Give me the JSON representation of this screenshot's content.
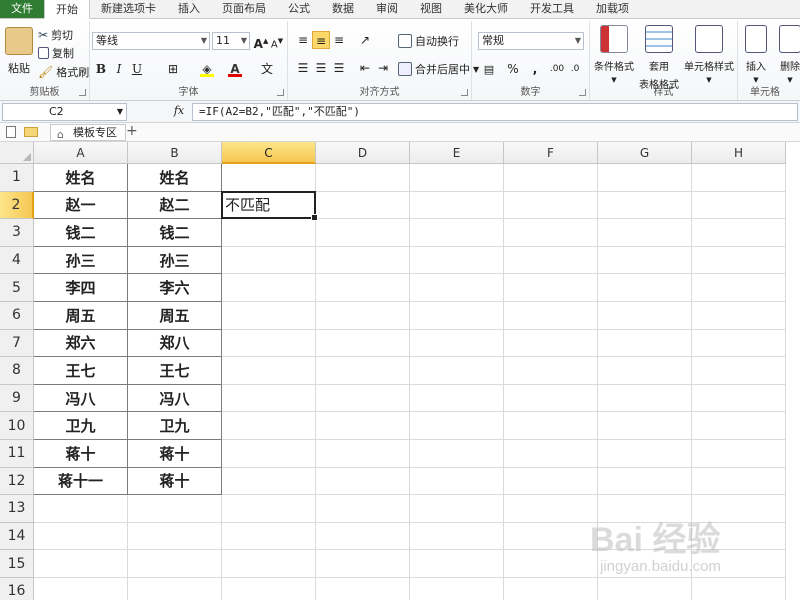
{
  "ribbon_tabs": [
    "文件",
    "开始",
    "新建选项卡",
    "插入",
    "页面布局",
    "公式",
    "数据",
    "审阅",
    "视图",
    "美化大师",
    "开发工具",
    "加载项"
  ],
  "active_tab": "开始",
  "clipboard": {
    "paste": "粘贴",
    "cut": "剪切",
    "copy": "复制",
    "format_painter": "格式刷",
    "label": "剪贴板"
  },
  "font": {
    "name": "等线",
    "size": "11",
    "grow": "A",
    "shrink": "A",
    "bold": "B",
    "italic": "I",
    "underline": "U",
    "label": "字体",
    "phonetic": "文"
  },
  "alignment": {
    "wrap": "自动换行",
    "merge": "合并后居中",
    "label": "对齐方式"
  },
  "number": {
    "format": "常规",
    "percent": "%",
    "comma": ",",
    "label": "数字"
  },
  "styles": {
    "conditional": "条件格式",
    "table_line1": "套用",
    "table_line2": "表格格式",
    "cell_styles": "单元格样式",
    "label": "样式"
  },
  "cells": {
    "insert": "插入",
    "delete": "删除",
    "label": "单元格"
  },
  "name_box": "C2",
  "fx": "fx",
  "formula": "=IF(A2=B2,\"匹配\",\"不匹配\")",
  "workbook_tab": "模板专区",
  "plus": "+",
  "columns": [
    "A",
    "B",
    "C",
    "D",
    "E",
    "F",
    "G",
    "H"
  ],
  "selected_column": "C",
  "rows": [
    "1",
    "2",
    "3",
    "4",
    "5",
    "6",
    "7",
    "8",
    "9",
    "10",
    "11",
    "12",
    "13",
    "14",
    "15",
    "16"
  ],
  "selected_row": "2",
  "sheet": {
    "A": [
      "姓名",
      "赵一",
      "钱二",
      "孙三",
      "李四",
      "周五",
      "郑六",
      "王七",
      "冯八",
      "卫九",
      "蒋十",
      "蒋十一"
    ],
    "B": [
      "姓名",
      "赵二",
      "钱二",
      "孙三",
      "李六",
      "周五",
      "郑八",
      "王七",
      "冯八",
      "卫九",
      "蒋十",
      "蒋十"
    ],
    "C2": "不匹配"
  },
  "watermark": {
    "brand": "Bai 经验",
    "url": "jingyan.baidu.com"
  },
  "colors": {
    "file_tab": "#2f7d32",
    "selection_header": "#f5c752",
    "cell_border_data": "#7a7a7a"
  }
}
